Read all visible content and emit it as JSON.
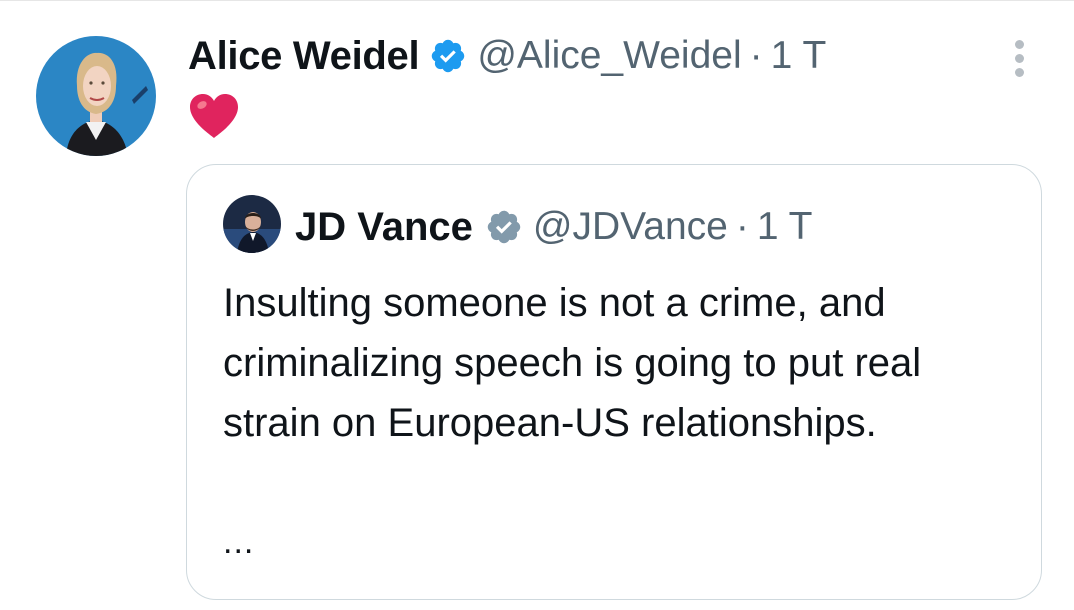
{
  "tweet": {
    "author_name": "Alice Weidel",
    "author_handle": "@Alice_Weidel",
    "separator": "·",
    "time": "1 T",
    "content_emoji": "red-heart-emoji",
    "verified_icon": "verified-badge-icon",
    "verified_color": "#1d9bf0",
    "more_icon": "more-options-icon"
  },
  "quoted_tweet": {
    "author_name": "JD Vance",
    "author_handle": "@JDVance",
    "separator": "·",
    "time": "1 T",
    "verified_icon": "verified-badge-icon",
    "verified_color": "#829aab",
    "text": "Insulting someone is not a crime, and criminalizing speech is going to put real strain on European-US relationships.",
    "ellipsis": "..."
  },
  "colors": {
    "text_primary": "#0f1419",
    "text_secondary": "#536471",
    "border": "#cfd9de",
    "heart": "#e0245e"
  }
}
